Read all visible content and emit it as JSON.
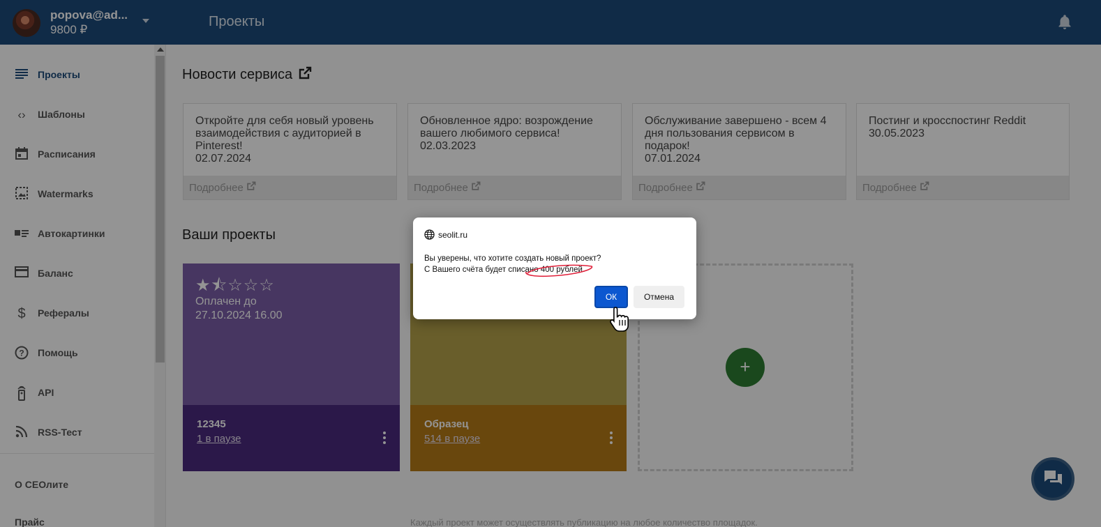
{
  "header": {
    "email": "popova@ad...",
    "balance": "9800 ₽",
    "title": "Проекты"
  },
  "sidebar": {
    "items": [
      {
        "label": "Проекты",
        "icon": "list-icon",
        "active": true
      },
      {
        "label": "Шаблоны",
        "icon": "code-icon"
      },
      {
        "label": "Расписания",
        "icon": "calendar-icon"
      },
      {
        "label": "Watermarks",
        "icon": "image-icon"
      },
      {
        "label": "Автокартинки",
        "icon": "image-text-icon"
      },
      {
        "label": "Баланс",
        "icon": "credit-card-icon"
      },
      {
        "label": "Рефералы",
        "icon": "dollar-icon"
      },
      {
        "label": "Помощь",
        "icon": "help-icon"
      },
      {
        "label": "API",
        "icon": "remote-icon"
      },
      {
        "label": "RSS-Тест",
        "icon": "rss-icon"
      }
    ],
    "about": "О СЕОлите",
    "price": "Прайс"
  },
  "news": {
    "title": "Новости сервиса",
    "more_label": "Подробнее",
    "cards": [
      {
        "text": "Откройте для себя новый уровень взаимодействия с аудиторией в Pinterest!",
        "date": "02.07.2024"
      },
      {
        "text": "Обновленное ядро: возрождение вашего любимого сервиса!",
        "date": "02.03.2023"
      },
      {
        "text": "Обслуживание завершено - всем 4 дня пользования сервисом в подарок!",
        "date": "07.01.2024"
      },
      {
        "text": "Постинг и кросспостинг Reddit",
        "date": "30.05.2023"
      }
    ]
  },
  "projects": {
    "title": "Ваши проекты",
    "items": [
      {
        "name": "12345",
        "paused": "1 в паузе",
        "stars": "★⯪☆☆☆",
        "paid_label": "Оплачен до",
        "paid_date": "27.10.2024 16.00",
        "top_color": "#7b5ea8",
        "bottom_color": "#4a2a7e"
      },
      {
        "name": "Образец",
        "paused": "514 в паузе",
        "top_color": "#b5a24b",
        "bottom_color": "#b57a18"
      }
    ],
    "add_symbol": "+"
  },
  "footnote": "Каждый проект может осуществлять публикацию на любое количество площадок.",
  "dialog": {
    "site": "seolit.ru",
    "line1": "Вы уверены, что хотите создать новый проект?",
    "line2": "С Вашего счёта будет списано 400 рублей.",
    "ok": "ОК",
    "cancel": "Отмена"
  }
}
